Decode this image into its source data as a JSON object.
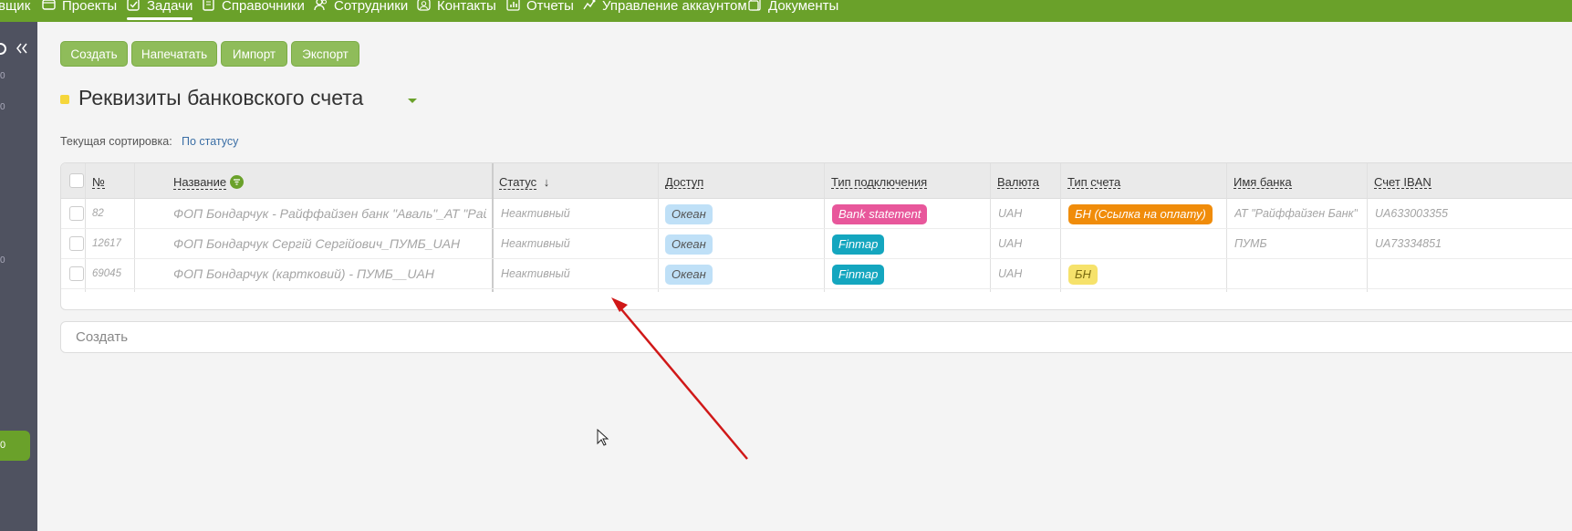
{
  "nav": {
    "items": [
      {
        "label": "вщик",
        "icon": ""
      },
      {
        "label": "Проекты",
        "icon": "folder-icon"
      },
      {
        "label": "Задачи",
        "icon": "checkbox-icon"
      },
      {
        "label": "Справочники",
        "icon": "book-icon"
      },
      {
        "label": "Сотрудники",
        "icon": "users-icon"
      },
      {
        "label": "Контакты",
        "icon": "contact-icon"
      },
      {
        "label": "Отчеты",
        "icon": "chart-icon"
      },
      {
        "label": "Управление аккаунтом",
        "icon": "account-icon"
      },
      {
        "label": "Документы",
        "icon": "document-icon"
      }
    ],
    "active": "Задачи",
    "color": "#6aa12a"
  },
  "sidebar": {
    "numbers": [
      "0",
      "0",
      "0"
    ],
    "active_item": "0"
  },
  "toolbar": {
    "create": "Создать",
    "print": "Напечатать",
    "import": "Импорт",
    "export": "Экспорт"
  },
  "page": {
    "title": "Реквизиты банковского счета",
    "sort_label": "Текущая сортировка:",
    "sort_value": "По статусу"
  },
  "table": {
    "headers": {
      "num": "№",
      "name": "Название",
      "status": "Статус",
      "access": "Доступ",
      "conn_type": "Тип подключения",
      "currency": "Валюта",
      "account_type": "Тип счета",
      "bank_name": "Имя банка",
      "iban": "Счет IBAN"
    },
    "rows": [
      {
        "num": "82",
        "name": "ФОП Бондарчук - Райффайзен банк \"Аваль\"_АТ \"Рай...",
        "status": "Неактивный",
        "access": "Океан",
        "conn_type": "Bank statement",
        "currency": "UAH",
        "account_type": "БН (Ссылка на оплату)",
        "bank_name": "АТ \"Райффайзен Банк\"",
        "iban": "UA633003355"
      },
      {
        "num": "12617",
        "name": "ФОП Бондарчук Сергій Сергійович_ПУМБ_UAH",
        "status": "Неактивный",
        "access": "Океан",
        "conn_type": "Finmap",
        "currency": "UAH",
        "account_type": "",
        "bank_name": "ПУМБ",
        "iban": "UA73334851"
      },
      {
        "num": "69045",
        "name": "ФОП Бондарчук (картковий) - ПУМБ__UAH",
        "status": "Неактивный",
        "access": "Океан",
        "conn_type": "Finmap",
        "currency": "UAH",
        "account_type": "БН",
        "bank_name": "",
        "iban": ""
      }
    ],
    "create_placeholder": "Создать"
  },
  "colors": {
    "bank_statement": "#e8579b",
    "finmap": "#14a6bf",
    "bn_link": "#f08c0a",
    "bn": "#f6e26b",
    "ocean": "#bfe0f7",
    "arrow": "#d01818"
  }
}
